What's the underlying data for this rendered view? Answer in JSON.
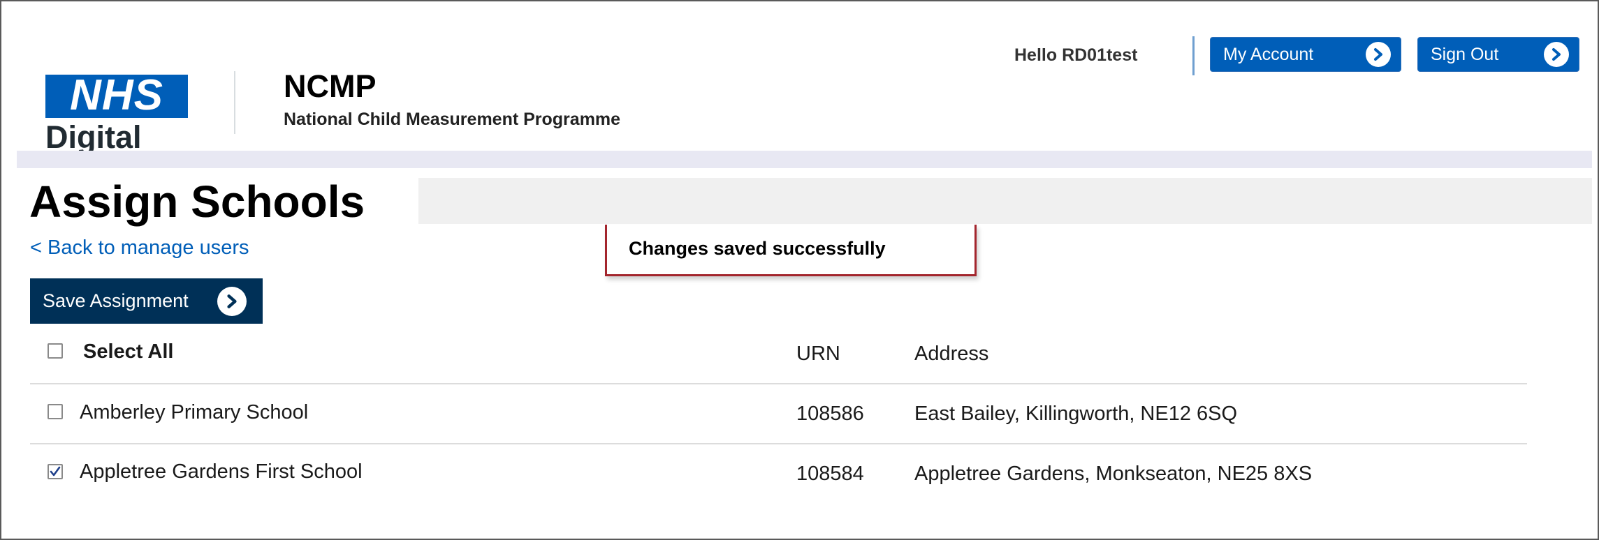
{
  "header": {
    "logo": {
      "org": "NHS",
      "division": "Digital",
      "brand_color": "#005eb8"
    },
    "app_title": "NCMP",
    "app_subtitle": "National Child Measurement Programme",
    "greeting": "Hello RD01test",
    "buttons": {
      "my_account": "My Account",
      "sign_out": "Sign Out"
    }
  },
  "page": {
    "title": "Assign Schools",
    "back_link": "< Back to manage users",
    "notification": "Changes saved successfully",
    "save_button": "Save Assignment"
  },
  "table": {
    "select_all_label": "Select All",
    "select_all_checked": false,
    "columns": {
      "urn": "URN",
      "address": "Address"
    },
    "rows": [
      {
        "name": "Amberley Primary School",
        "urn": "108586",
        "address": "East Bailey, Killingworth, NE12 6SQ",
        "checked": false
      },
      {
        "name": "Appletree Gardens First School",
        "urn": "108584",
        "address": "Appletree Gardens, Monkseaton, NE25 8XS",
        "checked": true
      }
    ]
  },
  "colors": {
    "nhs_blue": "#005eb8",
    "dark_button": "#003057",
    "notification_border": "#a3252d",
    "link": "#005eb8"
  },
  "icons": {
    "header_button_arrow": "chevron-right-circle-icon",
    "save_button_arrow": "chevron-right-circle-icon",
    "checked_box": "checkmark-icon"
  }
}
